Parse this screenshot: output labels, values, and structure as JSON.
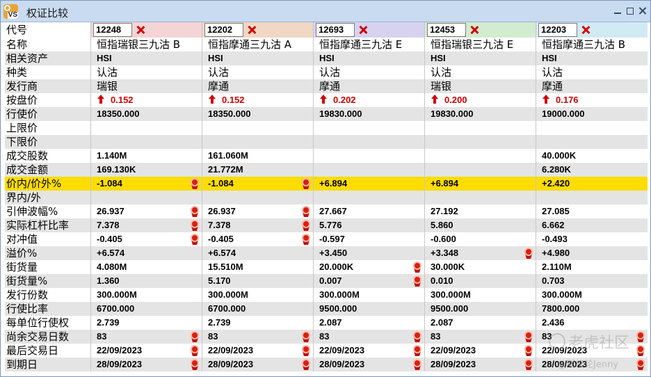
{
  "window": {
    "title": "权证比较",
    "app_icon_text": "VS"
  },
  "colors": {
    "col_headers": [
      "#f4d4d6",
      "#f0d8c4",
      "#d6d2f0",
      "#d2ecd0",
      "#d2eaf4"
    ],
    "highlight": "#ffdd00",
    "up": "#d10000"
  },
  "columns": [
    {
      "code": "12248",
      "name": "恒指瑞银三九沽 B",
      "asset": "HSI",
      "type": "认沽",
      "issuer": "瑞银",
      "close": "0.152",
      "strike": "18350.000",
      "upper": "",
      "lower": "",
      "volume": "1.140M",
      "turnover": "169.130K",
      "moneyness": "-1.084",
      "inout": "",
      "iv": "26.937",
      "eff_gearing": "7.378",
      "delta": "-0.405",
      "premium": "+6.574",
      "outstanding": "4.080M",
      "outstanding_pct": "1.360",
      "issue_size": "300.000M",
      "conv_ratio": "6700.000",
      "strike_per_unit": "2.739",
      "days_left": "83",
      "last_trade": "22/09/2023",
      "expiry": "28/09/2023",
      "medals": {
        "moneyness": true,
        "iv": true,
        "eff_gearing": true,
        "delta": true,
        "days_left": true,
        "last_trade": true,
        "expiry": true
      }
    },
    {
      "code": "12202",
      "name": "恒指摩通三九沽 A",
      "asset": "HSI",
      "type": "认沽",
      "issuer": "摩通",
      "close": "0.152",
      "strike": "18350.000",
      "upper": "",
      "lower": "",
      "volume": "161.060M",
      "turnover": "21.772M",
      "moneyness": "-1.084",
      "inout": "",
      "iv": "26.937",
      "eff_gearing": "7.378",
      "delta": "-0.405",
      "premium": "+6.574",
      "outstanding": "15.510M",
      "outstanding_pct": "5.170",
      "issue_size": "300.000M",
      "conv_ratio": "6700.000",
      "strike_per_unit": "2.739",
      "days_left": "83",
      "last_trade": "22/09/2023",
      "expiry": "28/09/2023",
      "medals": {
        "moneyness": true,
        "iv": true,
        "eff_gearing": true,
        "delta": true,
        "days_left": true,
        "last_trade": true,
        "expiry": true
      }
    },
    {
      "code": "12693",
      "name": "恒指摩通三九沽 E",
      "asset": "HSI",
      "type": "认沽",
      "issuer": "摩通",
      "close": "0.202",
      "strike": "19830.000",
      "upper": "",
      "lower": "",
      "volume": "",
      "turnover": "",
      "moneyness": "+6.894",
      "inout": "",
      "iv": "27.667",
      "eff_gearing": "5.776",
      "delta": "-0.597",
      "premium": "+3.450",
      "outstanding": "20.000K",
      "outstanding_pct": "0.007",
      "issue_size": "300.000M",
      "conv_ratio": "9500.000",
      "strike_per_unit": "2.087",
      "days_left": "83",
      "last_trade": "22/09/2023",
      "expiry": "28/09/2023",
      "medals": {
        "outstanding": true,
        "outstanding_pct": true,
        "days_left": true,
        "last_trade": true,
        "expiry": true
      }
    },
    {
      "code": "12453",
      "name": "恒指瑞银三九沽 E",
      "asset": "HSI",
      "type": "认沽",
      "issuer": "瑞银",
      "close": "0.200",
      "strike": "19830.000",
      "upper": "",
      "lower": "",
      "volume": "",
      "turnover": "",
      "moneyness": "+6.894",
      "inout": "",
      "iv": "27.192",
      "eff_gearing": "5.860",
      "delta": "-0.600",
      "premium": "+3.348",
      "outstanding": "30.000K",
      "outstanding_pct": "0.010",
      "issue_size": "300.000M",
      "conv_ratio": "9500.000",
      "strike_per_unit": "2.087",
      "days_left": "83",
      "last_trade": "22/09/2023",
      "expiry": "28/09/2023",
      "medals": {
        "premium": true,
        "days_left": true,
        "last_trade": true,
        "expiry": true
      }
    },
    {
      "code": "12203",
      "name": "恒指摩通三九沽 B",
      "asset": "HSI",
      "type": "认沽",
      "issuer": "摩通",
      "close": "0.176",
      "strike": "19000.000",
      "upper": "",
      "lower": "",
      "volume": "40.000K",
      "turnover": "6.280K",
      "moneyness": "+2.420",
      "inout": "",
      "iv": "27.085",
      "eff_gearing": "6.662",
      "delta": "-0.493",
      "premium": "+4.980",
      "outstanding": "2.110M",
      "outstanding_pct": "0.703",
      "issue_size": "300.000M",
      "conv_ratio": "7800.000",
      "strike_per_unit": "2.436",
      "days_left": "83",
      "last_trade": "22/09/2023",
      "expiry": "28/09/2023",
      "medals": {
        "days_left": true,
        "last_trade": true,
        "expiry": true
      }
    }
  ],
  "rows": [
    {
      "key": "name",
      "label": "名称",
      "style": "name"
    },
    {
      "key": "asset",
      "label": "相关资产",
      "style": "bold"
    },
    {
      "key": "type",
      "label": "种类",
      "style": "name"
    },
    {
      "key": "issuer",
      "label": "发行商",
      "style": "name"
    },
    {
      "key": "close",
      "label": "按盘价",
      "style": "price"
    },
    {
      "key": "strike",
      "label": "行使价",
      "style": "bold"
    },
    {
      "key": "upper",
      "label": "上限价",
      "style": "bold"
    },
    {
      "key": "lower",
      "label": "下限价",
      "style": "bold"
    },
    {
      "key": "volume",
      "label": "成交股数",
      "style": "bold"
    },
    {
      "key": "turnover",
      "label": "成交金额",
      "style": "bold"
    },
    {
      "key": "moneyness",
      "label": "价内/价外%",
      "style": "bold",
      "highlight": true
    },
    {
      "key": "inout",
      "label": "界内/外",
      "style": "bold"
    },
    {
      "key": "iv",
      "label": "引伸波幅%",
      "style": "bold"
    },
    {
      "key": "eff_gearing",
      "label": "实际杠杆比率",
      "style": "bold"
    },
    {
      "key": "delta",
      "label": "对冲值",
      "style": "bold"
    },
    {
      "key": "premium",
      "label": "溢价%",
      "style": "bold"
    },
    {
      "key": "outstanding",
      "label": "街货量",
      "style": "bold"
    },
    {
      "key": "outstanding_pct",
      "label": "街货量%",
      "style": "bold"
    },
    {
      "key": "issue_size",
      "label": "发行份数",
      "style": "bold"
    },
    {
      "key": "conv_ratio",
      "label": "行使比率",
      "style": "bold"
    },
    {
      "key": "strike_per_unit",
      "label": "每单位行使权",
      "style": "bold"
    },
    {
      "key": "days_left",
      "label": "尚余交易日数",
      "style": "bold"
    },
    {
      "key": "last_trade",
      "label": "最后交易日",
      "style": "bold"
    },
    {
      "key": "expiry",
      "label": "到期日",
      "style": "bold"
    }
  ],
  "header_label": "代号",
  "watermark": {
    "brand": "老虎社区",
    "author": "@期权轮Jenny"
  }
}
